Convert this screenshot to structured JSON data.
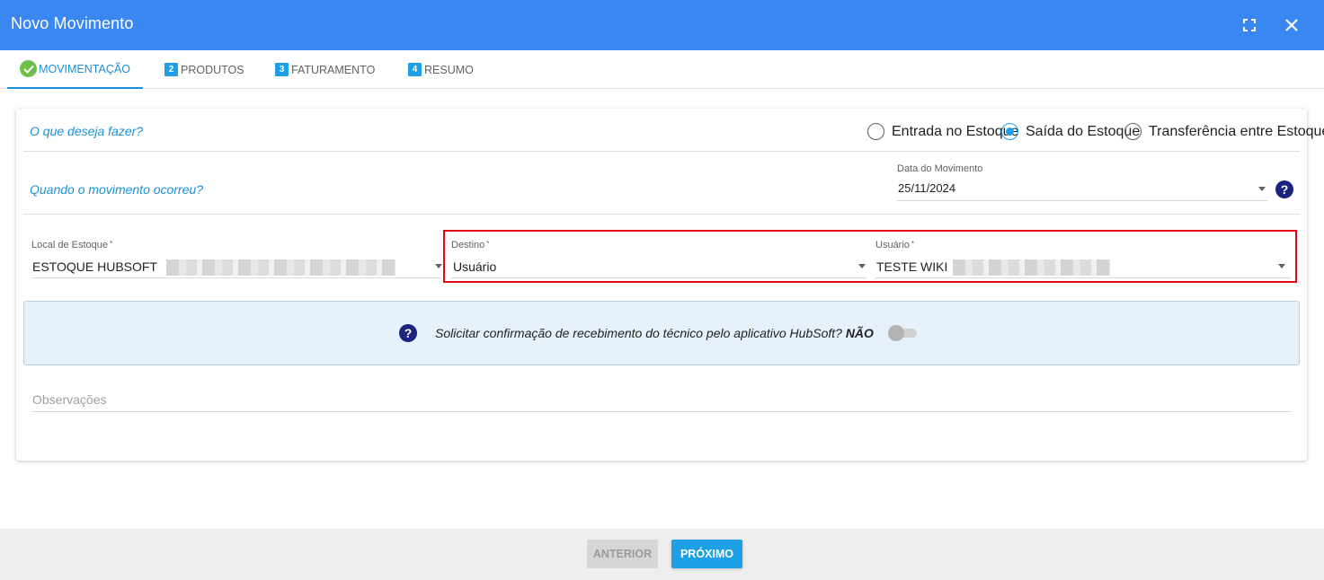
{
  "window": {
    "title": "Novo Movimento",
    "fullscreen_icon": "fullscreen-icon",
    "close_icon": "close-icon"
  },
  "tabs": [
    {
      "label": "MOVIMENTAÇÃO",
      "marker": "check-icon",
      "active": true
    },
    {
      "label": "PRODUTOS",
      "marker": "2",
      "active": false
    },
    {
      "label": "FATURAMENTO",
      "marker": "3",
      "active": false
    },
    {
      "label": "RESUMO",
      "marker": "4",
      "active": false
    }
  ],
  "form": {
    "question_what": "O que deseja fazer?",
    "question_when": "Quando o movimento ocorreu?",
    "movement_type": {
      "options": [
        "Entrada no Estoque",
        "Saída do Estoque",
        "Transferência entre Estoques"
      ],
      "selected": "Saída do Estoque"
    },
    "date": {
      "label": "Data do Movimento",
      "value": "25/11/2024",
      "help_icon": "question-icon"
    },
    "stock_location": {
      "label": "Local de Estoque",
      "required_mark": "*",
      "value": "ESTOQUE HUBSOFT"
    },
    "destination": {
      "label": "Destino",
      "required_mark": "*",
      "value": "Usuário"
    },
    "user": {
      "label": "Usuário",
      "required_mark": "*",
      "value": "TESTE WIKI"
    },
    "confirmation": {
      "text": "Solicitar confirmação de recebimento do técnico pelo aplicativo HubSoft?",
      "state_label": "NÃO",
      "enabled": false,
      "icon": "question-icon"
    },
    "observations_placeholder": "Observações"
  },
  "footer": {
    "prev_label": "ANTERIOR",
    "next_label": "PRÓXIMO"
  },
  "colors": {
    "header": "#3a87f2",
    "accent": "#1ea0e6",
    "highlight": "#e30613",
    "info_bg": "#e6f1fb"
  }
}
